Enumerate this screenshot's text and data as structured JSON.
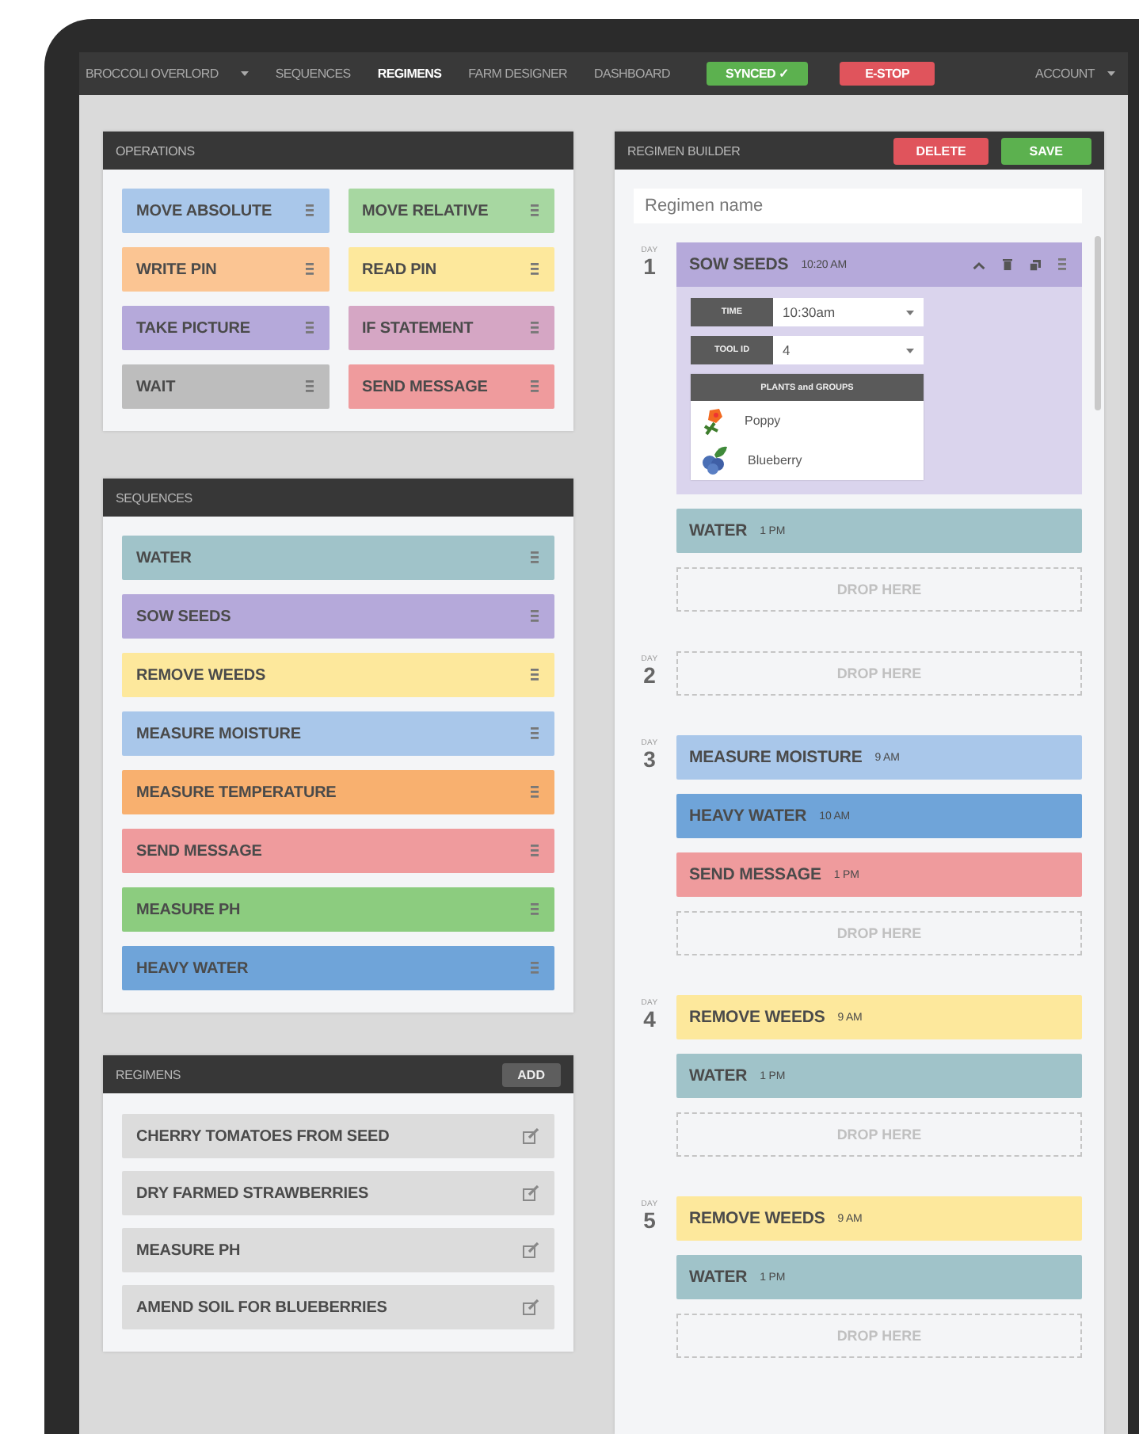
{
  "nav": {
    "items": [
      {
        "label": "BROCCOLI OVERLORD",
        "dropdown": true,
        "selected": false
      },
      {
        "label": "SEQUENCES",
        "dropdown": false,
        "selected": false
      },
      {
        "label": "REGIMENS",
        "dropdown": false,
        "selected": true
      },
      {
        "label": "FARM DESIGNER",
        "dropdown": false,
        "selected": false
      },
      {
        "label": "DASHBOARD",
        "dropdown": false,
        "selected": false
      }
    ],
    "sync": "SYNCED ✓",
    "estop": "E-STOP",
    "account": "ACCOUNT"
  },
  "operations": {
    "title": "OPERATIONS",
    "items": [
      {
        "label": "MOVE ABSOLUTE",
        "color": "#a9c7ea"
      },
      {
        "label": "MOVE RELATIVE",
        "color": "#a7d7a1"
      },
      {
        "label": "WRITE PIN",
        "color": "#fbc593"
      },
      {
        "label": "READ PIN",
        "color": "#fde89c"
      },
      {
        "label": "TAKE PICTURE",
        "color": "#b5a9da"
      },
      {
        "label": "IF STATEMENT",
        "color": "#d5a6c4"
      },
      {
        "label": "WAIT",
        "color": "#bdbdbd"
      },
      {
        "label": "SEND MESSAGE",
        "color": "#ef9b9d"
      }
    ]
  },
  "sequences": {
    "title": "SEQUENCES",
    "items": [
      {
        "label": "WATER",
        "color": "#a0c3c9"
      },
      {
        "label": "SOW SEEDS",
        "color": "#b5a9da"
      },
      {
        "label": "REMOVE WEEDS",
        "color": "#fde89c"
      },
      {
        "label": "MEASURE MOISTURE",
        "color": "#a9c7ea"
      },
      {
        "label": "MEASURE TEMPERATURE",
        "color": "#f8b06f"
      },
      {
        "label": "SEND MESSAGE",
        "color": "#ef9b9d"
      },
      {
        "label": "MEASURE PH",
        "color": "#8ccc7f"
      },
      {
        "label": "HEAVY WATER",
        "color": "#6fa4d9"
      }
    ]
  },
  "regimens": {
    "title": "REGIMENS",
    "add": "ADD",
    "items": [
      {
        "label": "CHERRY TOMATOES FROM SEED"
      },
      {
        "label": "DRY FARMED STRAWBERRIES"
      },
      {
        "label": "MEASURE PH"
      },
      {
        "label": "AMEND SOIL FOR BLUEBERRIES"
      }
    ]
  },
  "builder": {
    "title": "REGIMEN BUILDER",
    "delete": "DELETE",
    "save": "SAVE",
    "name_placeholder": "Regimen name",
    "days": [
      {
        "day_label": "DAY",
        "number": "1",
        "items": [
          {
            "name": "SOW SEEDS",
            "time": "10:20 AM",
            "color": "#b5a9da",
            "expanded": true,
            "fields": [
              {
                "label": "TIME",
                "value": "10:30am"
              },
              {
                "label": "TOOL ID",
                "value": "4"
              }
            ],
            "plants_header": "PLANTS and GROUPS",
            "plants": [
              {
                "name": "Poppy",
                "kind": "flower"
              },
              {
                "name": "Blueberry",
                "kind": "berry"
              }
            ]
          },
          {
            "name": "WATER",
            "time": "1 PM",
            "color": "#a0c3c9",
            "expanded": false
          }
        ],
        "drop": "DROP HERE"
      },
      {
        "day_label": "DAY",
        "number": "2",
        "drop": "DROP HERE"
      },
      {
        "day_label": "DAY",
        "number": "3",
        "items": [
          {
            "name": "MEASURE MOISTURE",
            "time": "9 AM",
            "color": "#a9c7ea",
            "expanded": false
          },
          {
            "name": "HEAVY WATER",
            "time": "10 AM",
            "color": "#6fa4d9",
            "expanded": false
          },
          {
            "name": "SEND MESSAGE",
            "time": "1 PM",
            "color": "#ef9b9d",
            "expanded": false
          }
        ],
        "drop": "DROP HERE"
      },
      {
        "day_label": "DAY",
        "number": "4",
        "items": [
          {
            "name": "REMOVE WEEDS",
            "time": "9 AM",
            "color": "#fde89c",
            "expanded": false
          },
          {
            "name": "WATER",
            "time": "1 PM",
            "color": "#a0c3c9",
            "expanded": false
          }
        ],
        "drop": "DROP HERE"
      },
      {
        "day_label": "DAY",
        "number": "5",
        "items": [
          {
            "name": "REMOVE WEEDS",
            "time": "9 AM",
            "color": "#fde89c",
            "expanded": false
          },
          {
            "name": "WATER",
            "time": "1 PM",
            "color": "#a0c3c9",
            "expanded": false
          }
        ],
        "drop": "DROP HERE"
      }
    ]
  }
}
